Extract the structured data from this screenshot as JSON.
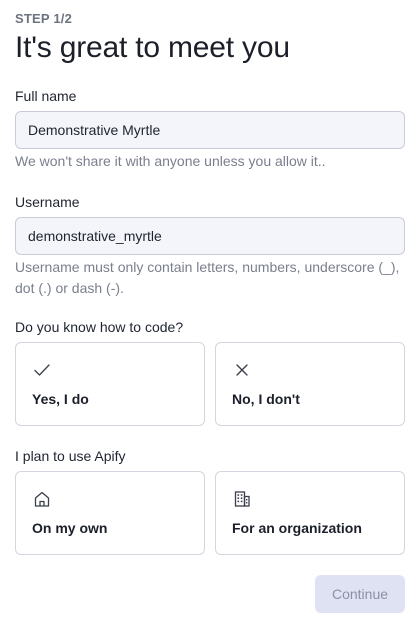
{
  "header": {
    "step": "STEP 1/2",
    "title": "It's great to meet you"
  },
  "full_name": {
    "label": "Full name",
    "value": "Demonstrative Myrtle",
    "hint": "We won't share it with anyone unless you allow it.."
  },
  "username": {
    "label": "Username",
    "value": "demonstrative_myrtle",
    "hint": "Username must only contain letters, numbers, underscore (_), dot (.) or dash (-)."
  },
  "coding": {
    "question": "Do you know how to code?",
    "options": [
      {
        "label": "Yes, I do",
        "icon": "checkmark-icon"
      },
      {
        "label": "No, I don't",
        "icon": "x-mark-icon"
      }
    ]
  },
  "usage": {
    "question": "I plan to use Apify",
    "options": [
      {
        "label": "On my own",
        "icon": "home-icon"
      },
      {
        "label": "For an organization",
        "icon": "building-icon"
      }
    ]
  },
  "actions": {
    "continue_label": "Continue",
    "continue_disabled": true
  },
  "colors": {
    "input_background": "#f4f5fa",
    "input_border": "#c8ccd8",
    "hint_text": "#7a7f8e",
    "button_disabled_bg": "#dfe2f3",
    "button_disabled_text": "#8b90a6"
  }
}
